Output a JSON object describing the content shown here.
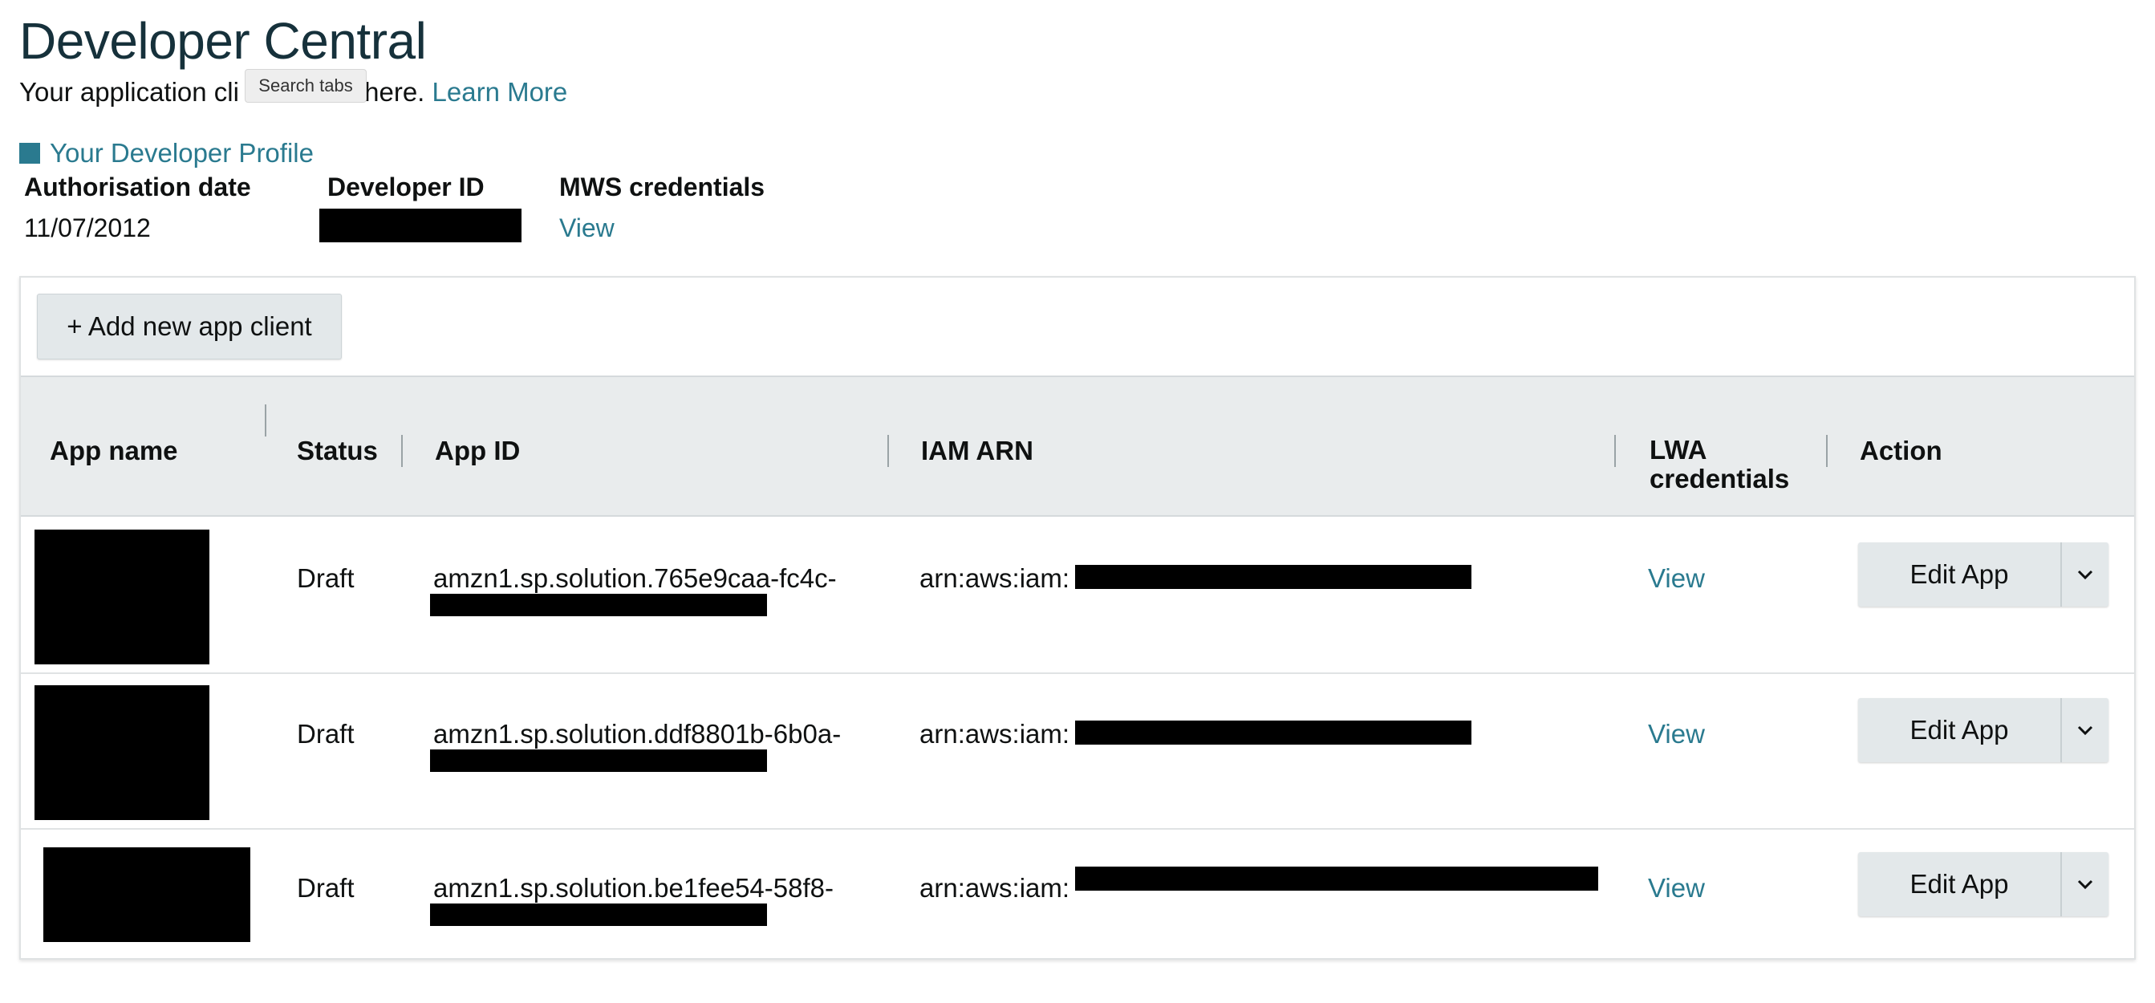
{
  "header": {
    "title": "Developer Central",
    "subtitle_before": "Your application cli",
    "subtitle_after": "r here.",
    "learn_more": "Learn More"
  },
  "tooltip": {
    "text": "Search tabs"
  },
  "profile": {
    "link_label": "Your Developer Profile",
    "auth_date_label": "Authorisation date",
    "auth_date_value": "11/07/2012",
    "developer_id_label": "Developer ID",
    "mws_label": "MWS credentials",
    "mws_view": "View"
  },
  "apps": {
    "add_button": "+ Add new app client",
    "columns": {
      "app_name": "App name",
      "status": "Status",
      "app_id": "App ID",
      "iam_arn": "IAM ARN",
      "lwa_line1": "LWA",
      "lwa_line2": "credentials",
      "action": "Action"
    },
    "rows": [
      {
        "status": "Draft",
        "app_id": "amzn1.sp.solution.765e9caa-fc4c-",
        "iam_arn": "arn:aws:iam:",
        "lwa": "View",
        "action": "Edit App"
      },
      {
        "status": "Draft",
        "app_id": "amzn1.sp.solution.ddf8801b-6b0a-",
        "iam_arn": "arn:aws:iam:",
        "lwa": "View",
        "action": "Edit App"
      },
      {
        "status": "Draft",
        "app_id": "amzn1.sp.solution.be1fee54-58f8-",
        "iam_arn": "arn:aws:iam:",
        "lwa": "View",
        "action": "Edit App"
      }
    ]
  },
  "colors": {
    "link": "#2a7a8f",
    "title": "#16313b",
    "header_bg": "#e9eced",
    "button_bg": "#e3e8ea"
  },
  "icons": {
    "dropdown": "chevron-down-icon",
    "profile_marker": "square-icon"
  }
}
